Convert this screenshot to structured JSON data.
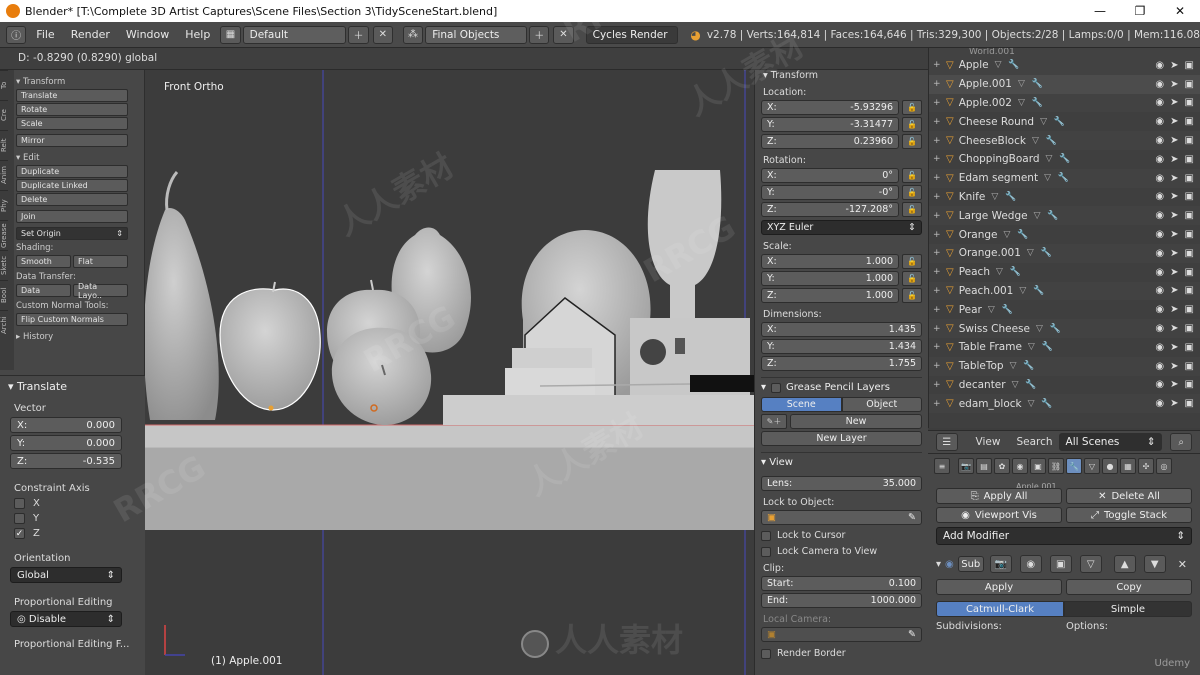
{
  "window": {
    "title": "Blender* [T:\\Complete 3D Artist Captures\\Scene Files\\Section 3\\TidySceneStart.blend]",
    "minimize": "—",
    "maximize": "❐",
    "close": "✕"
  },
  "topbar": {
    "menus": [
      "File",
      "Render",
      "Window",
      "Help"
    ],
    "layout": "Default",
    "scene": "Final Objects",
    "engine": "Cycles Render",
    "stats": "v2.78 | Verts:164,814 | Faces:164,646 | Tris:329,300 | Objects:2/28 | Lamps:0/0 | Mem:116.08"
  },
  "header2": {
    "text": "D: -0.8290 (0.8290) global"
  },
  "toolshelf": {
    "vtabs": [
      "To",
      "Cre",
      "Relt",
      "Anim",
      "Phy",
      "Grease",
      "Sketc",
      "Bool",
      "Archi"
    ],
    "transform_h": "▾ Transform",
    "transform": [
      "Translate",
      "Rotate",
      "Scale"
    ],
    "mirror": "Mirror",
    "edit_h": "▾ Edit",
    "edit": [
      "Duplicate",
      "Duplicate Linked",
      "Delete"
    ],
    "join": "Join",
    "set_origin": "Set Origin",
    "shading_h": "Shading:",
    "smooth": "Smooth",
    "flat": "Flat",
    "data_transfer_h": "Data Transfer:",
    "data": "Data",
    "data_layout": "Data Layo..",
    "custom_normal_h": "Custom Normal Tools:",
    "flip_normals": "Flip Custom Normals",
    "history_h": "▸ History"
  },
  "operator": {
    "title": "▾ Translate",
    "vector_label": "Vector",
    "x_label": "X:",
    "x": "0.000",
    "y_label": "Y:",
    "y": "0.000",
    "z_label": "Z:",
    "z": "-0.535",
    "constraint_label": "Constraint Axis",
    "ax_x": "X",
    "ax_y": "Y",
    "ax_z": "Z",
    "orientation_label": "Orientation",
    "orientation": "Global",
    "prop_label": "Proportional Editing",
    "prop_value": "Disable",
    "prop_falloff_label": "Proportional Editing F..."
  },
  "viewport": {
    "view_name": "Front Ortho",
    "active_object": "(1) Apple.001"
  },
  "props": {
    "transform_h": "▾ Transform",
    "location_label": "Location:",
    "loc": [
      {
        "a": "X:",
        "v": "-5.93296"
      },
      {
        "a": "Y:",
        "v": "-3.31477"
      },
      {
        "a": "Z:",
        "v": "0.23960"
      }
    ],
    "rotation_label": "Rotation:",
    "rot": [
      {
        "a": "X:",
        "v": "0°"
      },
      {
        "a": "Y:",
        "v": "-0°"
      },
      {
        "a": "Z:",
        "v": "-127.208°"
      }
    ],
    "euler": "XYZ Euler",
    "scale_label": "Scale:",
    "scale": [
      {
        "a": "X:",
        "v": "1.000"
      },
      {
        "a": "Y:",
        "v": "1.000"
      },
      {
        "a": "Z:",
        "v": "1.000"
      }
    ],
    "dimensions_label": "Dimensions:",
    "dim": [
      {
        "a": "X:",
        "v": "1.435"
      },
      {
        "a": "Y:",
        "v": "1.434"
      },
      {
        "a": "Z:",
        "v": "1.755"
      }
    ],
    "gp_h": "Grease Pencil Layers",
    "gp_scene": "Scene",
    "gp_object": "Object",
    "gp_new": "New",
    "gp_new_layer": "New Layer",
    "view_h": "▾ View",
    "lens_label": "Lens:",
    "lens": "35.000",
    "lock_object_label": "Lock to Object:",
    "lock_cursor": "Lock to Cursor",
    "lock_camera": "Lock Camera to View",
    "clip_label": "Clip:",
    "clip_start_label": "Start:",
    "clip_start": "0.100",
    "clip_end_label": "End:",
    "clip_end": "1000.000",
    "local_camera_label": "Local Camera:",
    "render_border": "Render Border"
  },
  "outliner": {
    "top_item": "World.001",
    "items": [
      "Apple",
      "Apple.001",
      "Apple.002",
      "Cheese Round",
      "CheeseBlock",
      "ChoppingBoard",
      "Edam segment",
      "Knife",
      "Large Wedge",
      "Orange",
      "Orange.001",
      "Peach",
      "Peach.001",
      "Pear",
      "Swiss Cheese",
      "Table Frame",
      "TableTop",
      "decanter",
      "edam_block"
    ],
    "view": "View",
    "search": "Search",
    "all_scenes": "All Scenes"
  },
  "modifiers": {
    "partial_name": "Apple.001",
    "apply_all": "Apply All",
    "delete_all": "Delete All",
    "viewport_vis": "Viewport Vis",
    "toggle_stack": "Toggle Stack",
    "add_modifier": "Add Modifier",
    "sub_name": "Sub",
    "apply": "Apply",
    "copy": "Copy",
    "catmull": "Catmull-Clark",
    "simple": "Simple",
    "subdivisions_label": "Subdivisions:",
    "options_label": "Options:"
  },
  "watermarks": [
    "RRCG",
    "人人素材",
    "RRCG",
    "人人素材",
    "RRCG",
    "人人素材",
    "RRCG",
    "人人素材"
  ],
  "brand": {
    "udemy": "Udemy"
  },
  "colors": {
    "accent": "#5680c2",
    "object_orange": "#e8a033",
    "selection_outline": "#ffffff"
  }
}
